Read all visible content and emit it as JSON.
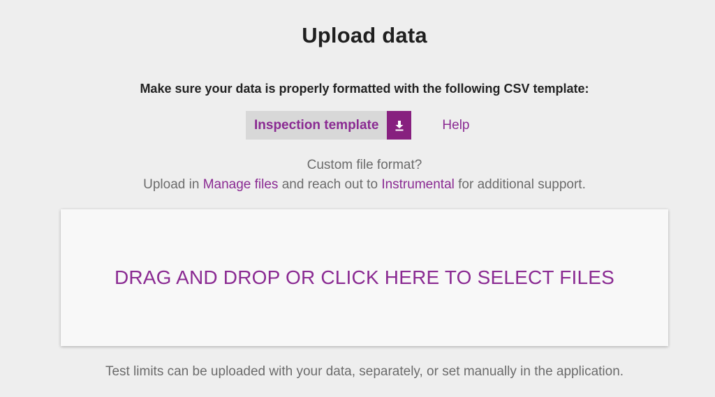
{
  "page": {
    "title": "Upload data",
    "instructions": "Make sure your data is properly formatted with the following CSV template:",
    "template_button": {
      "label": "Inspection template",
      "icon": "download-icon"
    },
    "help_link": "Help",
    "custom_format": "Custom file format?",
    "upload_line": {
      "prefix": "Upload in",
      "manage_files_link": "Manage files",
      "middle": "and reach out to",
      "instrumental_link": "Instrumental",
      "suffix": "for additional support."
    },
    "dropzone_text": "DRAG AND DROP OR CLICK HERE TO SELECT FILES",
    "footer_note": "Test limits can be uploaded with your data, separately, or set manually in the application."
  },
  "colors": {
    "background": "#eeeeee",
    "accent": "#8a2a92",
    "accent_dark": "#87207f",
    "button_bg": "#d8d8d8",
    "muted_text": "#6b6b6b"
  }
}
